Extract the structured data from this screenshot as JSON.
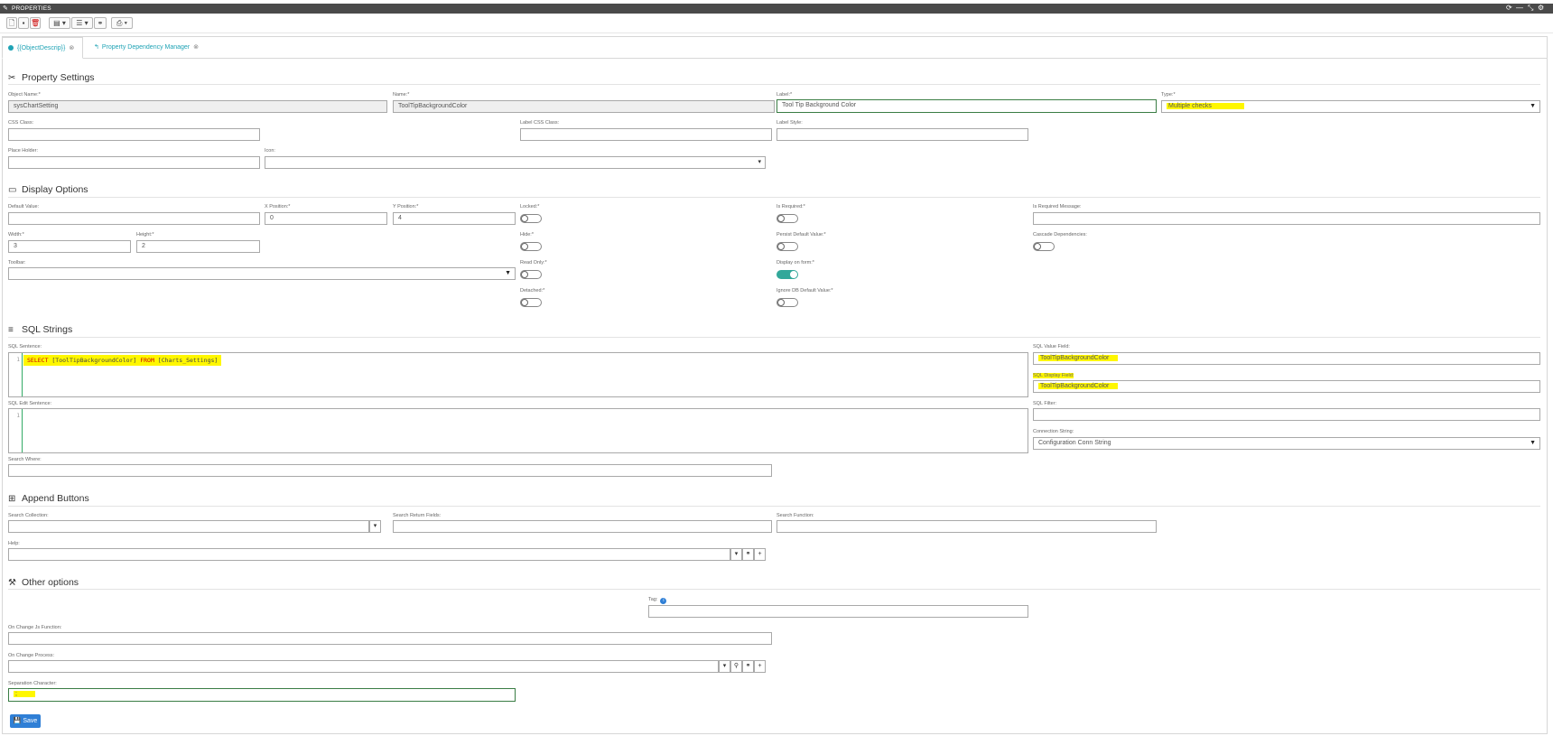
{
  "window": {
    "title": "PROPERTIES",
    "controls": [
      "refresh-icon",
      "minimize-icon",
      "unpin-icon",
      "settings-icon"
    ]
  },
  "toolbar": {
    "buttons": [
      "new-icon",
      "save-icon",
      "delete-icon",
      "layout-menu",
      "list-menu",
      "link-icon",
      "print-menu"
    ]
  },
  "tabs": [
    {
      "label": "{{ObjectDescrip}}",
      "active": true
    },
    {
      "label": "Property Dependency Manager",
      "active": false
    }
  ],
  "property_settings": {
    "title": "Property Settings",
    "object_name": {
      "label": "Object Name:*",
      "value": "sysChartSetting"
    },
    "name": {
      "label": "Name:*",
      "value": "ToolTipBackgroundColor"
    },
    "label": {
      "label": "Label:*",
      "value": "Tool Tip Background Color"
    },
    "type": {
      "label": "Type:*",
      "value": "Multiple checks"
    },
    "css_class": {
      "label": "CSS Class:",
      "value": ""
    },
    "label_css_class": {
      "label": "Label CSS Class:",
      "value": ""
    },
    "label_style": {
      "label": "Label Style:",
      "value": ""
    },
    "place_holder": {
      "label": "Place Holder:",
      "value": ""
    },
    "icon": {
      "label": "Icon:",
      "value": ""
    }
  },
  "display_options": {
    "title": "Display Options",
    "default_value": {
      "label": "Default Value:",
      "value": ""
    },
    "x_position": {
      "label": "X Position:*",
      "value": "0"
    },
    "y_position": {
      "label": "Y Position:*",
      "value": "4"
    },
    "width": {
      "label": "Width:*",
      "value": "3"
    },
    "height": {
      "label": "Height:*",
      "value": "2"
    },
    "toolbar": {
      "label": "Toolbar:",
      "value": ""
    },
    "locked": {
      "label": "Locked:*",
      "on": false
    },
    "hide": {
      "label": "Hide:*",
      "on": false
    },
    "read_only": {
      "label": "Read Only:*",
      "on": false
    },
    "detached": {
      "label": "Detached:*",
      "on": false
    },
    "is_required": {
      "label": "Is Required:*",
      "on": false
    },
    "persist_default": {
      "label": "Persist Default Value:*",
      "on": false
    },
    "display_on_form": {
      "label": "Display on form:*",
      "on": true
    },
    "ignore_db_default": {
      "label": "Ignore DB Default Value:*",
      "on": false
    },
    "is_required_message": {
      "label": "Is Required Message:",
      "value": ""
    },
    "cascade_dependencies": {
      "label": "Cascade Dependencies:",
      "on": false
    }
  },
  "sql_strings": {
    "title": "SQL Strings",
    "sql_sentence": {
      "label": "SQL Sentence:",
      "line": "1",
      "tokens": [
        "SELECT",
        " [ToolTipBackgroundColor] ",
        "FROM",
        " [Charts_Settings]"
      ]
    },
    "sql_edit_sentence": {
      "label": "SQL Edit Sentence:",
      "line": "1"
    },
    "search_where": {
      "label": "Search Where:",
      "value": ""
    },
    "sql_value_field": {
      "label": "SQL Value Field:",
      "value": "ToolTipBackgroundColor"
    },
    "sql_display_field": {
      "label": "SQL Display Field:",
      "value": "ToolTipBackgroundColor"
    },
    "sql_filter": {
      "label": "SQL Filter:",
      "value": ""
    },
    "connection_string": {
      "label": "Connection String:",
      "value": "Configuration Conn String"
    }
  },
  "append_buttons": {
    "title": "Append Buttons",
    "search_collection": {
      "label": "Search Collection:",
      "value": ""
    },
    "search_return_fields": {
      "label": "Search Return Fields:",
      "value": ""
    },
    "search_function": {
      "label": "Search Function:",
      "value": ""
    },
    "help": {
      "label": "Help:",
      "value": ""
    }
  },
  "other_options": {
    "title": "Other options",
    "tag": {
      "label": "Tag:",
      "value": ""
    },
    "on_change_js": {
      "label": "On Change Js Function:",
      "value": ""
    },
    "on_change_process": {
      "label": "On Change Process:",
      "value": ""
    },
    "separation_character": {
      "label": "Separation Character:",
      "value": ";"
    }
  },
  "save": {
    "label": "Save"
  },
  "colors": {
    "highlight": "#fff700",
    "accent": "#1fa3b5",
    "save": "#2f7fd6",
    "toggle_on": "#32a89a"
  }
}
